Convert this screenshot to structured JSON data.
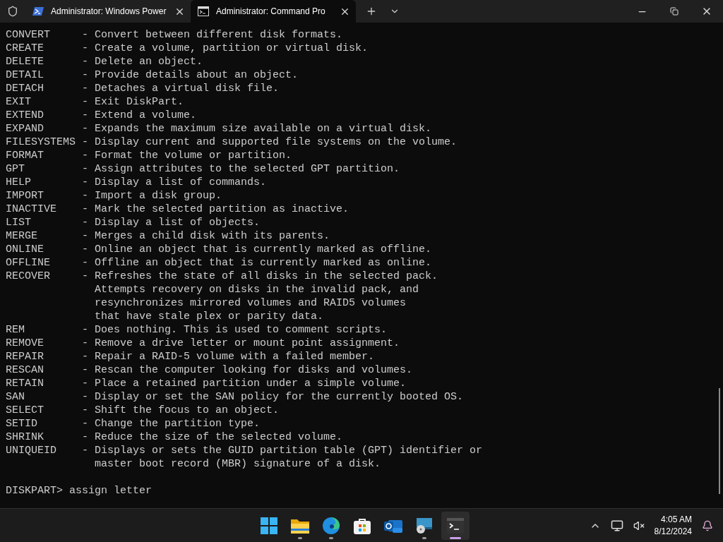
{
  "tabs": [
    {
      "title": "Administrator: Windows Power",
      "selected": false,
      "kind": "powershell"
    },
    {
      "title": "Administrator: Command Pro",
      "selected": true,
      "kind": "cmd"
    }
  ],
  "commands": [
    {
      "name": "CONVERT",
      "lines": [
        "- Convert between different disk formats."
      ]
    },
    {
      "name": "CREATE",
      "lines": [
        "- Create a volume, partition or virtual disk."
      ]
    },
    {
      "name": "DELETE",
      "lines": [
        "- Delete an object."
      ]
    },
    {
      "name": "DETAIL",
      "lines": [
        "- Provide details about an object."
      ]
    },
    {
      "name": "DETACH",
      "lines": [
        "- Detaches a virtual disk file."
      ]
    },
    {
      "name": "EXIT",
      "lines": [
        "- Exit DiskPart."
      ]
    },
    {
      "name": "EXTEND",
      "lines": [
        "- Extend a volume."
      ]
    },
    {
      "name": "EXPAND",
      "lines": [
        "- Expands the maximum size available on a virtual disk."
      ]
    },
    {
      "name": "FILESYSTEMS",
      "lines": [
        "- Display current and supported file systems on the volume."
      ]
    },
    {
      "name": "FORMAT",
      "lines": [
        "- Format the volume or partition."
      ]
    },
    {
      "name": "GPT",
      "lines": [
        "- Assign attributes to the selected GPT partition."
      ]
    },
    {
      "name": "HELP",
      "lines": [
        "- Display a list of commands."
      ]
    },
    {
      "name": "IMPORT",
      "lines": [
        "- Import a disk group."
      ]
    },
    {
      "name": "INACTIVE",
      "lines": [
        "- Mark the selected partition as inactive."
      ]
    },
    {
      "name": "LIST",
      "lines": [
        "- Display a list of objects."
      ]
    },
    {
      "name": "MERGE",
      "lines": [
        "- Merges a child disk with its parents."
      ]
    },
    {
      "name": "ONLINE",
      "lines": [
        "- Online an object that is currently marked as offline."
      ]
    },
    {
      "name": "OFFLINE",
      "lines": [
        "- Offline an object that is currently marked as online."
      ]
    },
    {
      "name": "RECOVER",
      "lines": [
        "- Refreshes the state of all disks in the selected pack.",
        "Attempts recovery on disks in the invalid pack, and",
        "resynchronizes mirrored volumes and RAID5 volumes",
        "that have stale plex or parity data."
      ]
    },
    {
      "name": "REM",
      "lines": [
        "- Does nothing. This is used to comment scripts."
      ]
    },
    {
      "name": "REMOVE",
      "lines": [
        "- Remove a drive letter or mount point assignment."
      ]
    },
    {
      "name": "REPAIR",
      "lines": [
        "- Repair a RAID-5 volume with a failed member."
      ]
    },
    {
      "name": "RESCAN",
      "lines": [
        "- Rescan the computer looking for disks and volumes."
      ]
    },
    {
      "name": "RETAIN",
      "lines": [
        "- Place a retained partition under a simple volume."
      ]
    },
    {
      "name": "SAN",
      "lines": [
        "- Display or set the SAN policy for the currently booted OS."
      ]
    },
    {
      "name": "SELECT",
      "lines": [
        "- Shift the focus to an object."
      ]
    },
    {
      "name": "SETID",
      "lines": [
        "- Change the partition type."
      ]
    },
    {
      "name": "SHRINK",
      "lines": [
        "- Reduce the size of the selected volume."
      ]
    },
    {
      "name": "UNIQUEID",
      "lines": [
        "- Displays or sets the GUID partition table (GPT) identifier or",
        "master boot record (MBR) signature of a disk."
      ]
    }
  ],
  "prompt": "DISKPART> assign letter",
  "taskbar": {
    "apps": [
      {
        "kind": "start",
        "running": false,
        "selected": false
      },
      {
        "kind": "folder",
        "running": true,
        "selected": false
      },
      {
        "kind": "edge",
        "running": true,
        "selected": false
      },
      {
        "kind": "store",
        "running": false,
        "selected": false
      },
      {
        "kind": "outlook",
        "running": false,
        "selected": false
      },
      {
        "kind": "disc",
        "running": true,
        "selected": false
      },
      {
        "kind": "terminal",
        "running": true,
        "selected": true
      }
    ],
    "time": "4:05 AM",
    "date": "8/12/2024"
  }
}
